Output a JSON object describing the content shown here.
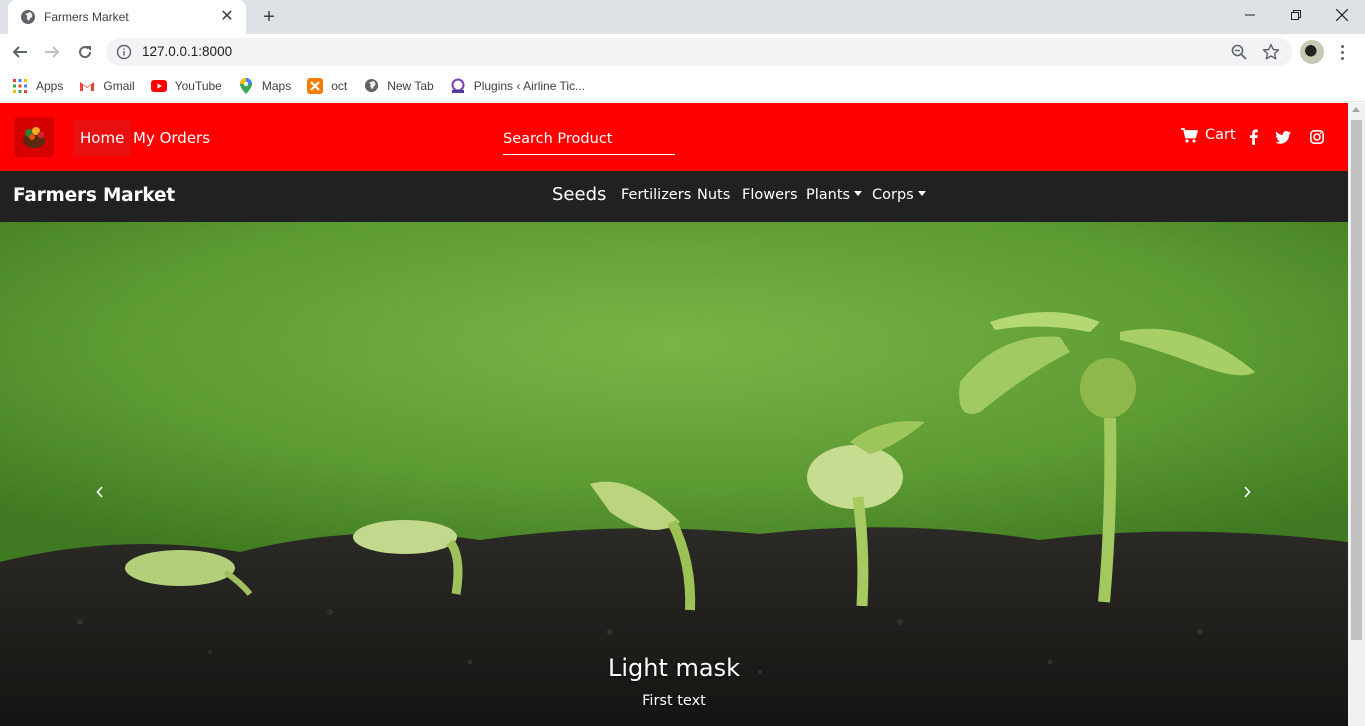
{
  "browser": {
    "tab_title": "Farmers Market",
    "url": "127.0.0.1:8000",
    "bookmarks": [
      "Apps",
      "Gmail",
      "YouTube",
      "Maps",
      "oct",
      "New Tab",
      "Plugins ‹ Airline Tic..."
    ]
  },
  "topnav": {
    "home": "Home",
    "my_orders": "My Orders",
    "search_placeholder": "Search Product",
    "cart": "Cart"
  },
  "secnav": {
    "brand": "Farmers Market",
    "categories": {
      "seeds": "Seeds",
      "fertilizers": "Fertilizers",
      "nuts": "Nuts",
      "flowers": "Flowers",
      "plants": "Plants",
      "corps": "Corps"
    }
  },
  "carousel": {
    "caption_title": "Light mask",
    "caption_text": "First text"
  },
  "colors": {
    "topnav_bg": "#ff0000",
    "secnav_bg": "#212121"
  }
}
